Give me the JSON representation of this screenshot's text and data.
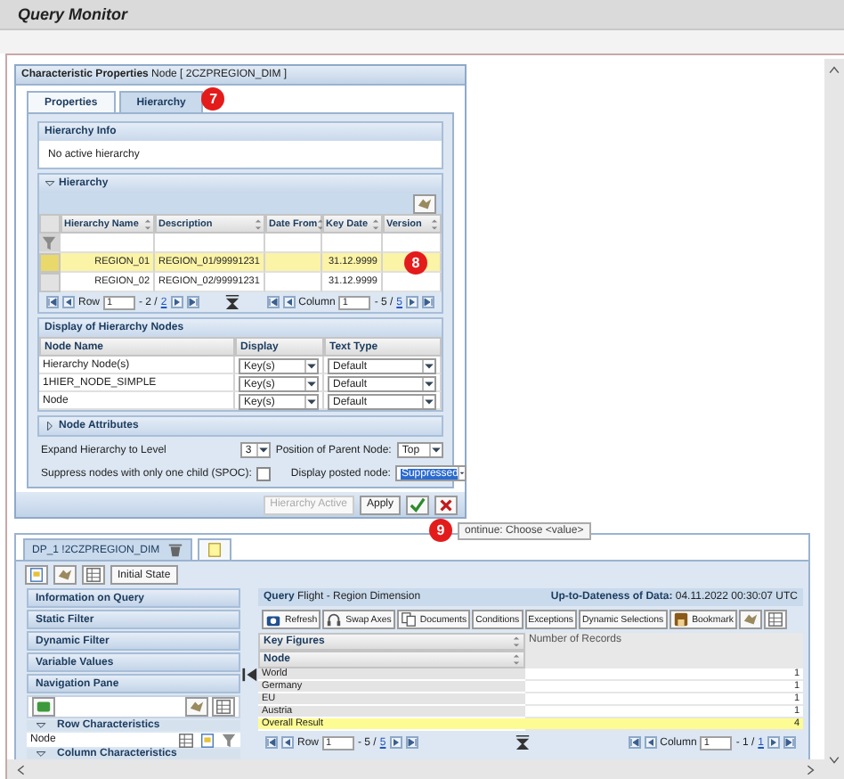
{
  "window": {
    "title": "Query Monitor"
  },
  "dialog": {
    "title": "Characteristic Properties",
    "subtitle": "Node [ 2CZPREGION_DIM ]",
    "tabs": [
      {
        "label": "Properties",
        "selected": false
      },
      {
        "label": "Hierarchy",
        "selected": true
      }
    ],
    "tab_badge": "7",
    "hierarchy_info": {
      "title": "Hierarchy Info",
      "text": "No active hierarchy"
    },
    "hierarchy": {
      "title": "Hierarchy",
      "expanded": true,
      "columns": [
        "Hierarchy Name",
        "Description",
        "Date From",
        "Key Date",
        "Version"
      ],
      "rows": [
        {
          "name": "REGION_01",
          "description": "REGION_01/99991231",
          "key_date": "31.12.9999",
          "selected": true
        },
        {
          "name": "REGION_02",
          "description": "REGION_02/99991231",
          "key_date": "31.12.9999",
          "selected": false
        }
      ],
      "row_badge": "8",
      "row_pager": {
        "label": "Row",
        "value": "1",
        "range": "- 2 /",
        "total": "2"
      },
      "column_pager": {
        "label": "Column",
        "value": "1",
        "range": "- 5 /",
        "total": "5"
      }
    },
    "display_nodes": {
      "title": "Display of Hierarchy Nodes",
      "columns": [
        "Node Name",
        "Display",
        "Text Type"
      ],
      "rows": [
        {
          "name": "Hierarchy Node(s)",
          "display": "Key(s)",
          "text_type": "Default"
        },
        {
          "name": "1HIER_NODE_SIMPLE",
          "display": "Key(s)",
          "text_type": "Default"
        },
        {
          "name": "Node",
          "display": "Key(s)",
          "text_type": "Default"
        }
      ]
    },
    "node_attributes": {
      "title": "Node Attributes",
      "expanded": false
    },
    "expand_level": {
      "label": "Expand Hierarchy to Level",
      "value": "3"
    },
    "parent_position": {
      "label": "Position of Parent Node:",
      "value": "Top"
    },
    "suppress_spoc": {
      "label": "Suppress nodes with only one child (SPOC):",
      "checked": false
    },
    "posted_node": {
      "label": "Display posted node:",
      "value": "Suppressed",
      "text_selected": true
    },
    "buttons": [
      {
        "label": "Hierarchy Active",
        "disabled": true
      },
      {
        "label": "Apply",
        "disabled": false
      }
    ],
    "ok_badge": "9",
    "tooltip": "ontinue: Choose <value>"
  },
  "workbook": {
    "tabs": [
      {
        "label": "DP_1 !2CZPREGION_DIM",
        "selected": true
      },
      {
        "selected": false
      }
    ],
    "toolbar_button": "Initial State",
    "nav": {
      "sections": [
        "Information on Query",
        "Static Filter",
        "Dynamic Filter",
        "Variable Values",
        "Navigation Pane"
      ],
      "row_header": "Row Characteristics",
      "row_items": [
        "Node"
      ],
      "column_header": "Column Characteristics"
    },
    "query": {
      "label": "Query",
      "title": "Flight - Region Dimension",
      "freshness_label": "Up-to-Dateness of Data:",
      "freshness_value": "04.11.2022 00:30:07 UTC",
      "buttons": [
        {
          "kind": "icon_label",
          "label": "Refresh"
        },
        {
          "kind": "icon_label",
          "label": "Swap Axes"
        },
        {
          "kind": "icon_label",
          "label": "Documents"
        },
        {
          "kind": "label",
          "label": "Conditions"
        },
        {
          "kind": "label",
          "label": "Exceptions"
        },
        {
          "kind": "label",
          "label": "Dynamic Selections"
        },
        {
          "kind": "icon_label",
          "label": "Bookmark"
        },
        {
          "kind": "icon"
        },
        {
          "kind": "icon"
        }
      ],
      "table": {
        "columns": [
          "Key Figures",
          "Number of Records"
        ],
        "row_header": "Node",
        "rows": [
          {
            "node": "World",
            "value": "1",
            "kind": "data"
          },
          {
            "node": "Germany",
            "value": "1",
            "kind": "data"
          },
          {
            "node": "EU",
            "value": "1",
            "kind": "data"
          },
          {
            "node": "Austria",
            "value": "1",
            "kind": "data"
          },
          {
            "node": "Overall Result",
            "value": "4",
            "kind": "result"
          }
        ]
      },
      "row_pager": {
        "label": "Row",
        "value": "1",
        "range": "- 5 /",
        "total": "5"
      },
      "column_pager": {
        "label": "Column",
        "value": "1",
        "range": "- 1 /",
        "total": "1"
      }
    }
  }
}
